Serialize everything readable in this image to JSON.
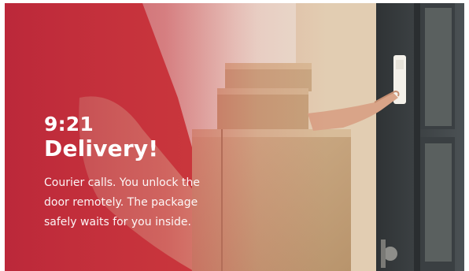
{
  "promo": {
    "time": "9:21",
    "headline": "Delivery!",
    "description": "Courier calls. You unlock the door remotely. The package safely waits for you inside."
  },
  "colors": {
    "overlay": "#d0333d",
    "shirt": "#c83a3a",
    "box": "#c8a882",
    "door_frame": "#3f4446",
    "wall": "#e6d7c4"
  },
  "image": {
    "subject": "courier-ringing-doorbell-with-packages"
  }
}
